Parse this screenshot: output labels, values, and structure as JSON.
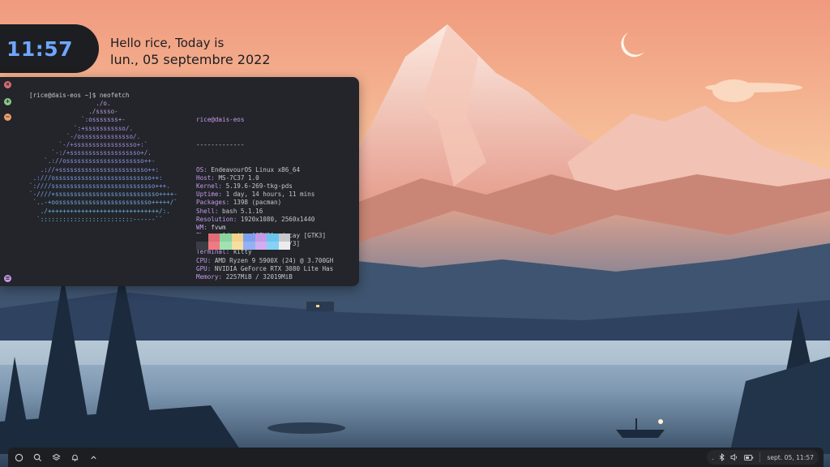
{
  "clock": {
    "time": "11:57"
  },
  "greeting": {
    "line1": "Hello rice, Today is",
    "line2": "lun., 05 septembre 2022"
  },
  "terminal": {
    "prompt": "[rice@dais-eos ~]$ neofetch",
    "logo": [
      "                  ./o.",
      "                ./sssso-",
      "              `:osssssss+-",
      "            `:+sssssssssso/.",
      "          `-/ossssssssssssso/.",
      "        `-/+sssssssssssssssso+:`",
      "      `-:/+sssssssssssssssssso+/.",
      "    `.://osssssssssssssssssssso++-",
      "   .://+ssssssssssssssssssssssso++:",
      " .:///ossssssssssssssssssssssssso++:",
      "`:////ssssssssssssssssssssssssssso+++.",
      "`-////+ssssssssssssssssssssssssssso++++-",
      " `..-+oosssssssssssssssssssssssso+++++/`",
      "   ./++++++++++++++++++++++++++++++/:.",
      "  `:::::::::::::::::::::::::------``"
    ],
    "user_host": "rice@dais-eos",
    "separator": "-------------",
    "info": [
      {
        "key": "OS",
        "value": "EndeavourOS Linux x86_64"
      },
      {
        "key": "Host",
        "value": "MS-7C37 1.0"
      },
      {
        "key": "Kernel",
        "value": "5.19.6-269-tkg-pds"
      },
      {
        "key": "Uptime",
        "value": "1 day, 14 hours, 11 mins"
      },
      {
        "key": "Packages",
        "value": "1398 (pacman)"
      },
      {
        "key": "Shell",
        "value": "bash 5.1.16"
      },
      {
        "key": "Resolution",
        "value": "1920x1080, 2560x1440"
      },
      {
        "key": "WM",
        "value": "fvwm"
      },
      {
        "key": "Theme",
        "value": "Adwaita [GTK2], decay [GTK3]"
      },
      {
        "key": "Icons",
        "value": "Papirus-Dark [GTK2/3]"
      },
      {
        "key": "Terminal",
        "value": "kitty"
      },
      {
        "key": "CPU",
        "value": "AMD Ryzen 9 5900X (24) @ 3.700GH"
      },
      {
        "key": "GPU",
        "value": "NVIDIA GeForce RTX 3080 Lite Has"
      },
      {
        "key": "Memory",
        "value": "2257MiB / 32019MiB"
      }
    ],
    "palette_top": [
      "#23252a",
      "#e06c75",
      "#8bd3a0",
      "#f0d28a",
      "#7ea0ec",
      "#c49be8",
      "#6bc4f0",
      "#c6c8cc"
    ],
    "palette_bottom": [
      "#3a3d44",
      "#f07a84",
      "#9fe3b2",
      "#f6dea0",
      "#92b2f4",
      "#d2aef0",
      "#86d2f4",
      "#ececec"
    ]
  },
  "window_buttons": {
    "close": "×",
    "maximize": "+",
    "minimize": "−",
    "menu": "≡"
  },
  "taskbar": {
    "left_icons": [
      "launcher-icon",
      "search-icon",
      "layers-icon",
      "bell-icon",
      "chevron-up-icon"
    ],
    "tray_icons": [
      "dot-icon",
      "bluetooth-icon",
      "volume-icon",
      "battery-icon"
    ],
    "datetime": "sept. 05, 11:57"
  },
  "colors": {
    "clock_text": "#6fa6ff",
    "panel_bg": "#1c1e22",
    "accent_purple": "#c49be8"
  }
}
